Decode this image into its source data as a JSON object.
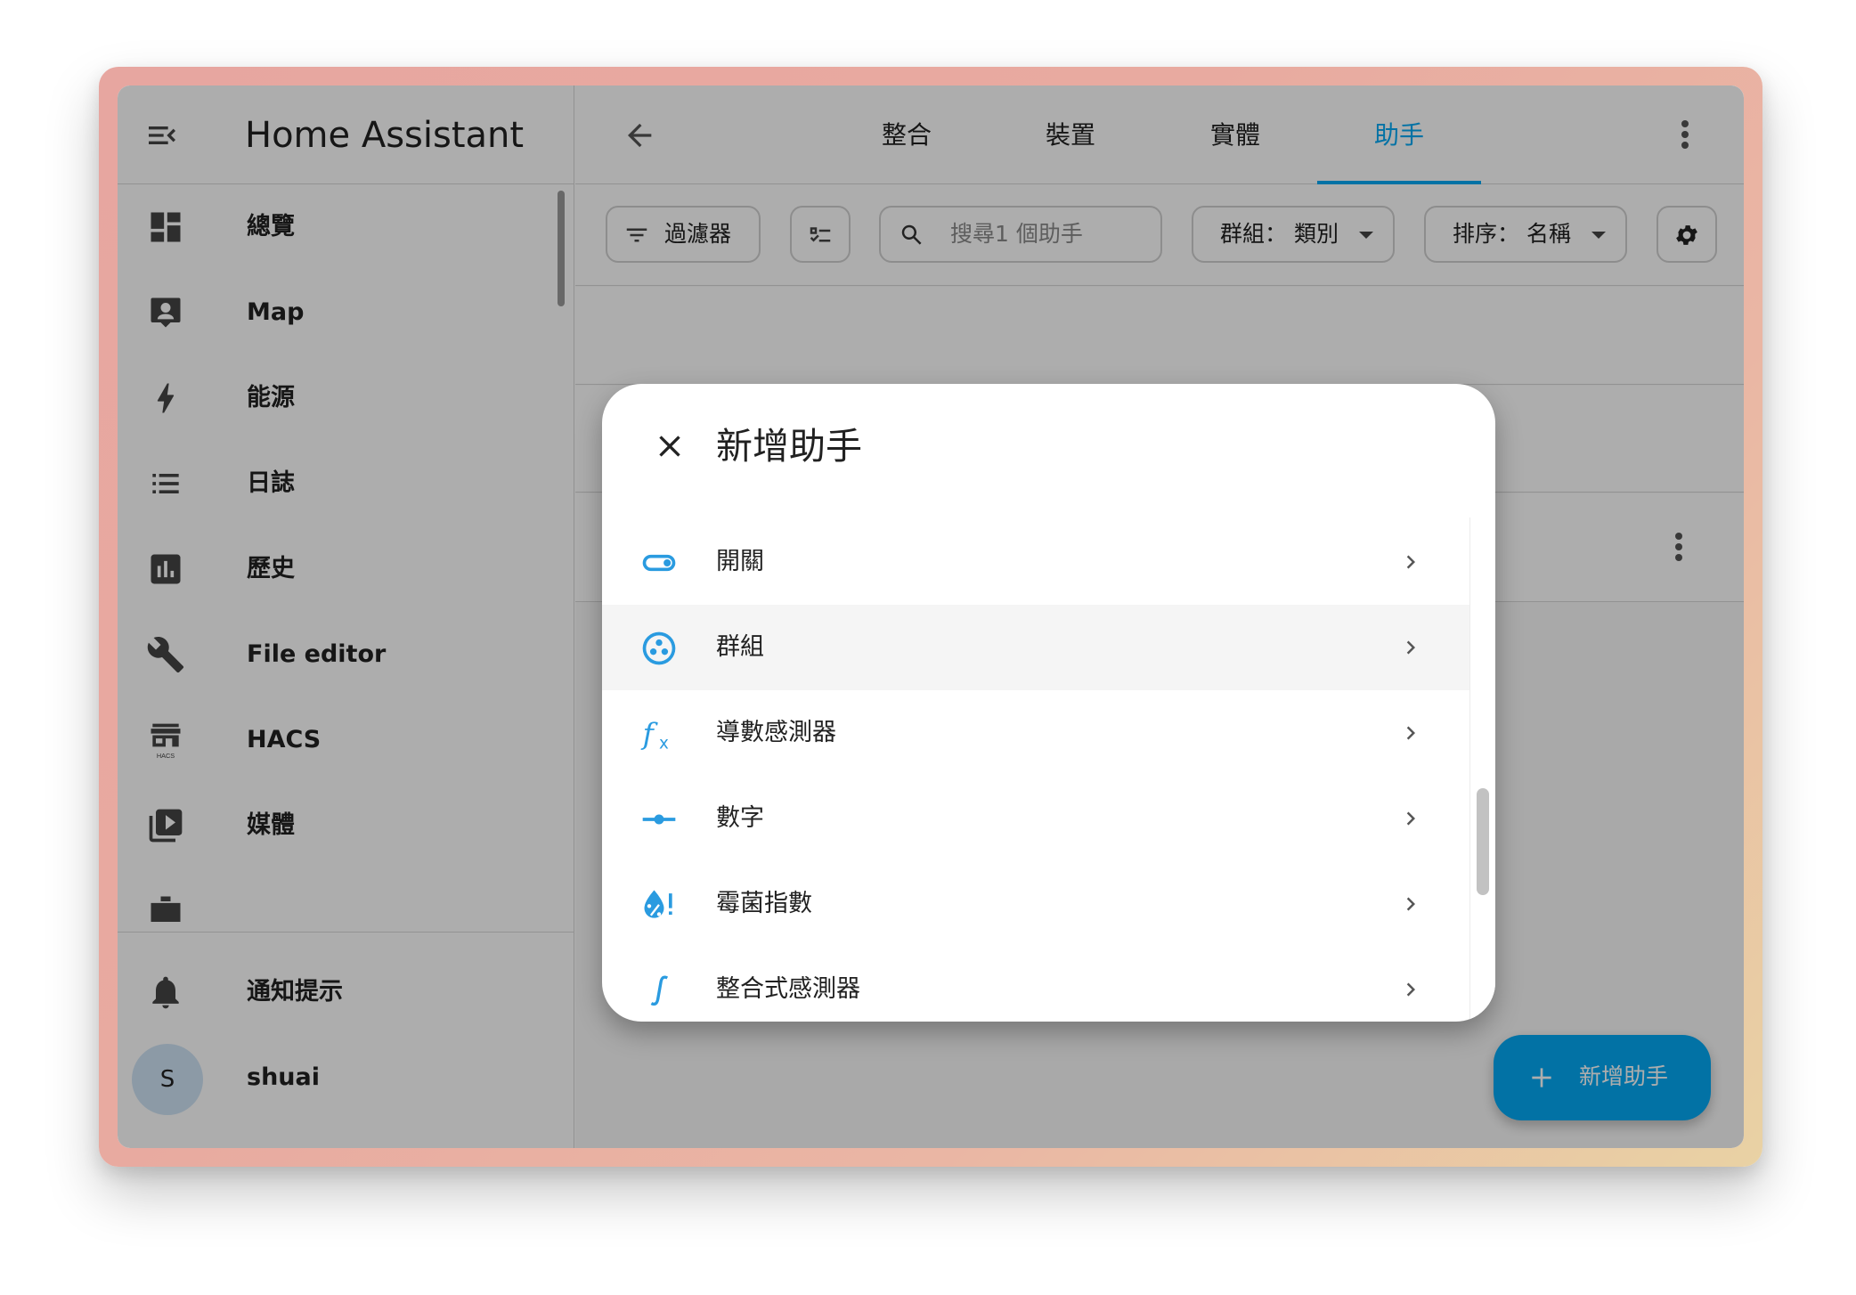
{
  "app": {
    "title": "Home Assistant"
  },
  "sidebar": {
    "items": [
      {
        "label": "總覽",
        "icon": "dashboard-icon"
      },
      {
        "label": "Map",
        "icon": "account-box-icon"
      },
      {
        "label": "能源",
        "icon": "lightning-bolt-icon"
      },
      {
        "label": "日誌",
        "icon": "format-list-bulleted-icon"
      },
      {
        "label": "歷史",
        "icon": "chart-box-icon"
      },
      {
        "label": "File editor",
        "icon": "wrench-icon"
      },
      {
        "label": "HACS",
        "icon": "hacs-icon"
      },
      {
        "label": "媒體",
        "icon": "play-box-multiple-icon"
      }
    ],
    "notifications_label": "通知提示",
    "user": {
      "initial": "S",
      "name": "shuai"
    }
  },
  "topbar": {
    "tabs": [
      {
        "label": "整合"
      },
      {
        "label": "裝置"
      },
      {
        "label": "實體"
      },
      {
        "label": "助手",
        "active": true
      }
    ]
  },
  "toolbar": {
    "filter_label": "過濾器",
    "search_placeholder": "搜尋1 個助手",
    "group_label": "群組： 類別",
    "sort_label": "排序： 名稱"
  },
  "fab": {
    "label": "新增助手"
  },
  "dialog": {
    "title": "新增助手",
    "items": [
      {
        "label": "開關",
        "icon": "toggle-switch-icon"
      },
      {
        "label": "群組",
        "icon": "group-circle-icon",
        "highlighted": true
      },
      {
        "label": "導數感測器",
        "icon": "function-variant-icon"
      },
      {
        "label": "數字",
        "icon": "ray-vertex-icon"
      },
      {
        "label": "霉菌指數",
        "icon": "water-percent-alert-icon"
      },
      {
        "label": "整合式感測器",
        "icon": "integral-icon"
      }
    ]
  },
  "colors": {
    "accent": "#03a9f4",
    "icon_gray": "#444444",
    "text": "#212121"
  }
}
